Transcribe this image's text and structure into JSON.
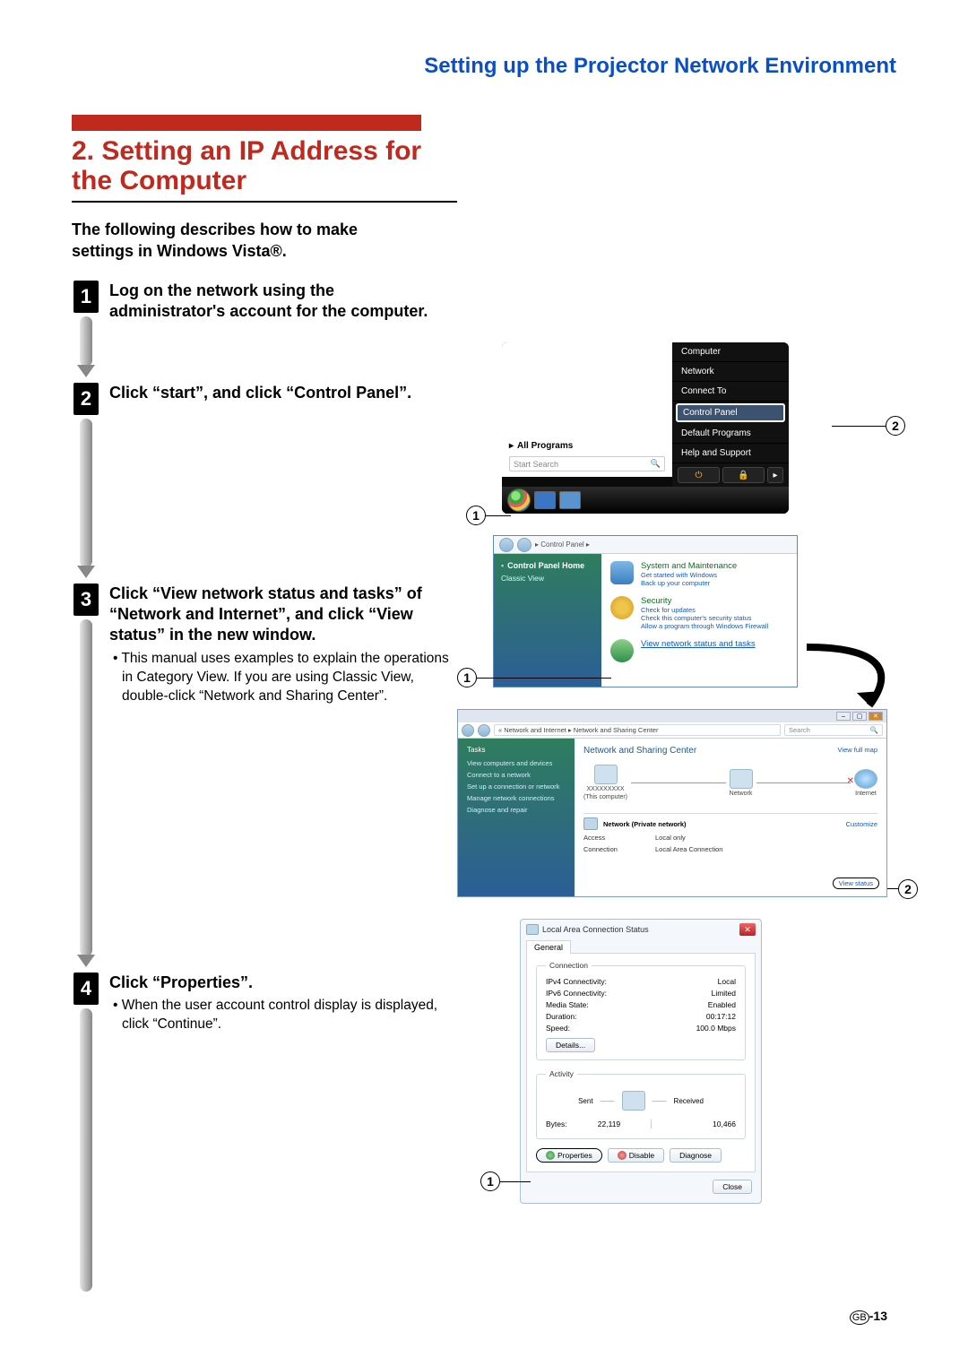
{
  "header": "Setting up the Projector Network Environment",
  "section_title": "2. Setting an IP Address for the Computer",
  "intro": "The following describes how to make settings in Windows Vista®.",
  "steps": {
    "s1": {
      "num": "1",
      "heading": "Log on the network using the administrator's account for the computer."
    },
    "s2": {
      "num": "2",
      "heading": "Click “start”, and click “Control Panel”."
    },
    "s3": {
      "num": "3",
      "heading": "Click “View network status and tasks” of “Network and Internet”, and click “View status” in the new window.",
      "bullet": "This manual uses examples to explain the operations in Category View. If you are using Classic View, double-click “Network and Sharing Center”."
    },
    "s4": {
      "num": "4",
      "heading": "Click “Properties”.",
      "bullet": "When the user account control display is displayed, click “Continue”."
    }
  },
  "startmenu": {
    "items": [
      "Computer",
      "Network",
      "Connect To",
      "Control Panel",
      "Default Programs",
      "Help and Support"
    ],
    "all_programs": "All Programs",
    "search_placeholder": "Start Search"
  },
  "cpanel": {
    "crumb": "▸ Control Panel ▸",
    "side_home": "Control Panel Home",
    "side_classic": "Classic View",
    "sys_title": "System and Maintenance",
    "sys_l1": "Get started with Windows",
    "sys_l2": "Back up your computer",
    "sec_title": "Security",
    "sec_l1": "Check for updates",
    "sec_l2": "Check this computer's security status",
    "sec_l3": "Allow a program through Windows Firewall",
    "net_link": "View network status and tasks"
  },
  "nsc": {
    "crumb": "« Network and Internet ▸ Network and Sharing Center",
    "search": "Search",
    "tasks_header": "Tasks",
    "tasks": [
      "View computers and devices",
      "Connect to a network",
      "Set up a connection or network",
      "Manage network connections",
      "Diagnose and repair"
    ],
    "title": "Network and Sharing Center",
    "view_full_map": "View full map",
    "this_computer_name": "XXXXXXXXX",
    "this_computer_label": "(This computer)",
    "node_network": "Network",
    "node_internet": "Internet",
    "net_label": "Network (Private network)",
    "customize": "Customize",
    "access_k": "Access",
    "access_v": "Local only",
    "conn_k": "Connection",
    "conn_v": "Local Area Connection",
    "view_status": "View status"
  },
  "lac": {
    "title": "Local Area Connection Status",
    "tab": "General",
    "legend_conn": "Connection",
    "rows": {
      "ipv4_k": "IPv4 Connectivity:",
      "ipv4_v": "Local",
      "ipv6_k": "IPv6 Connectivity:",
      "ipv6_v": "Limited",
      "media_k": "Media State:",
      "media_v": "Enabled",
      "dur_k": "Duration:",
      "dur_v": "00:17:12",
      "spd_k": "Speed:",
      "spd_v": "100.0 Mbps"
    },
    "details_btn": "Details...",
    "legend_act": "Activity",
    "sent": "Sent",
    "received": "Received",
    "bytes_k": "Bytes:",
    "bytes_sent": "22,119",
    "bytes_recv": "10,466",
    "props_btn": "Properties",
    "disable_btn": "Disable",
    "diag_btn": "Diagnose",
    "close_btn": "Close"
  },
  "callouts": {
    "one": "1",
    "two": "2"
  },
  "page_num": {
    "gb": "GB",
    "n": "-13"
  }
}
